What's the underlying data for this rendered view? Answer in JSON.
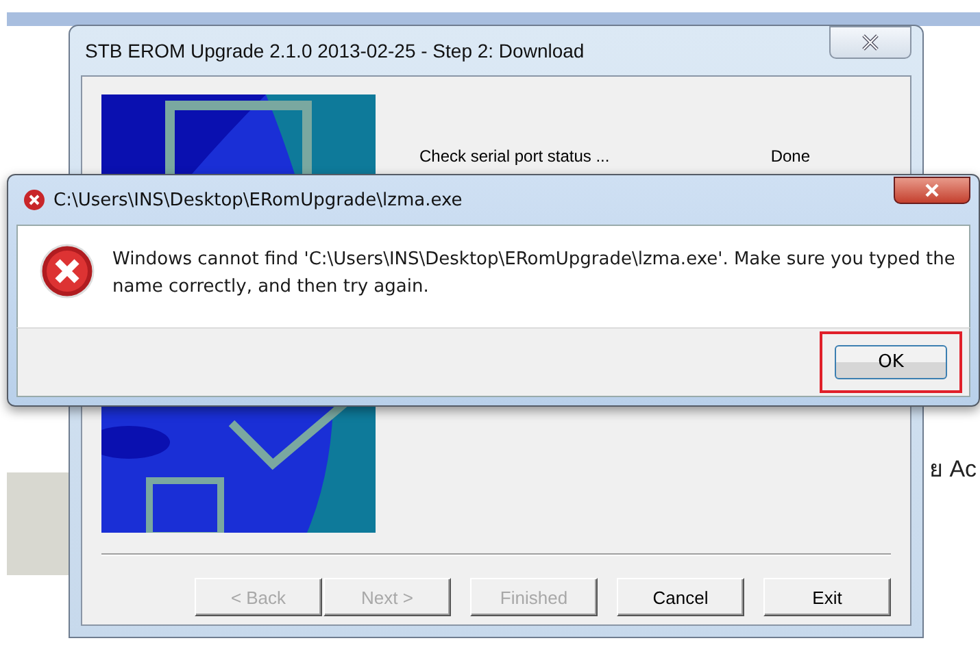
{
  "background_page": {
    "side_text": "ย Ac"
  },
  "main_window": {
    "title": "STB EROM Upgrade 2.1.0 2013-02-25 - Step 2: Download",
    "status_rows": [
      {
        "label": "Check serial port status ...",
        "result": "Done"
      }
    ],
    "buttons": [
      {
        "label": "< Back",
        "disabled": true
      },
      {
        "label": "Next >",
        "disabled": true
      },
      {
        "label": "Finished",
        "disabled": true
      },
      {
        "label": "Cancel",
        "disabled": false
      },
      {
        "label": "Exit",
        "disabled": false
      }
    ]
  },
  "error_dialog": {
    "title": "C:\\Users\\INS\\Desktop\\ERomUpgrade\\lzma.exe",
    "message": "Windows cannot find 'C:\\Users\\INS\\Desktop\\ERomUpgrade\\lzma.exe'. Make sure you typed the name correctly, and then try again.",
    "button": {
      "label": "OK",
      "highlighted": true
    }
  }
}
